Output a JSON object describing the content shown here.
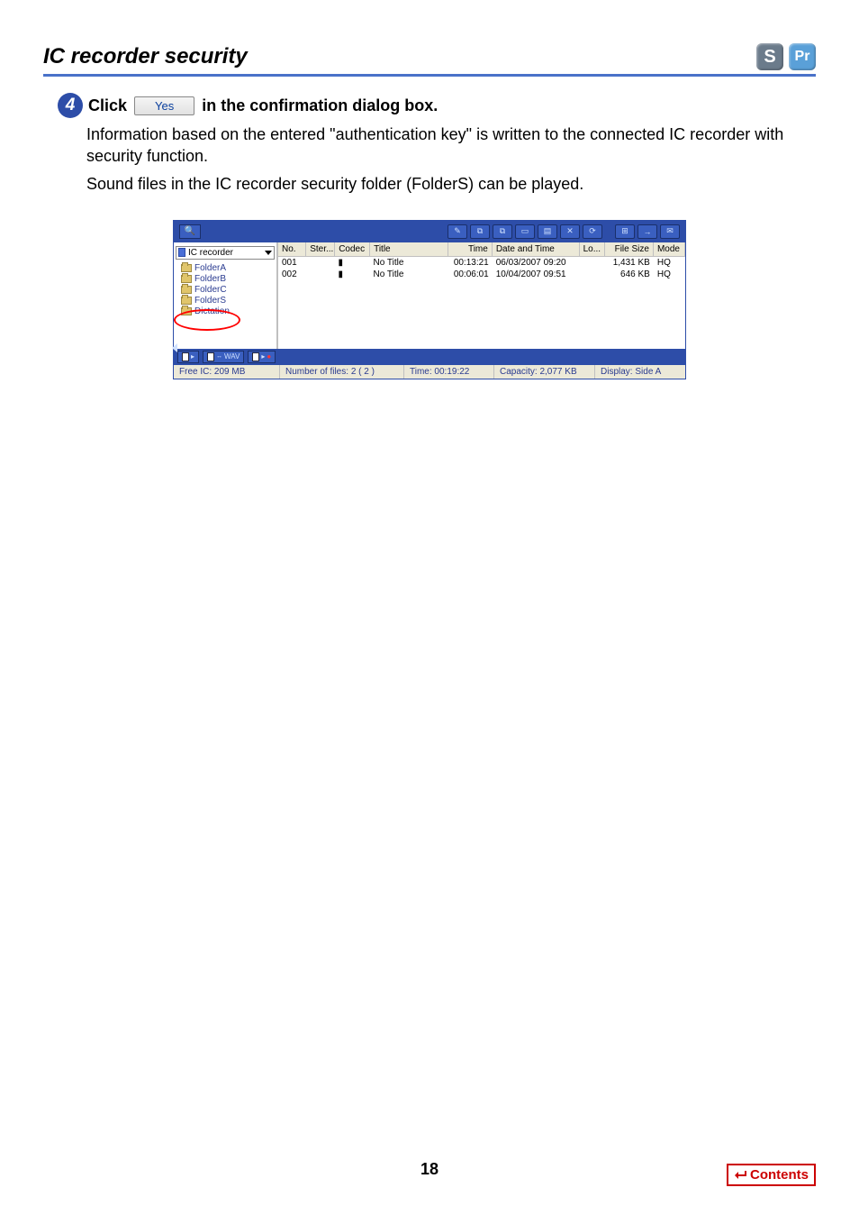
{
  "header": {
    "title": "IC recorder security",
    "badge_s": "S",
    "badge_pr": "Pr"
  },
  "step": {
    "num": "4",
    "pre": "Click",
    "btn": "Yes",
    "post": "in the confirmation dialog box."
  },
  "body": {
    "p1": "Information based on the entered \"authentication key\" is written to the connected IC recorder with security function.",
    "p2": "Sound files in the IC recorder security folder (FolderS) can be played."
  },
  "tree": {
    "top": "IC recorder",
    "items": [
      "FolderA",
      "FolderB",
      "FolderC",
      "FolderS",
      "Dictation"
    ]
  },
  "cols": {
    "no": "No.",
    "ster": "Ster...",
    "codec": "Codec",
    "title": "Title",
    "time": "Time",
    "date": "Date and Time",
    "lo": "Lo...",
    "fs": "File Size",
    "mode": "Mode"
  },
  "rows": [
    {
      "no": "001",
      "title": "No Title",
      "time": "00:13:21",
      "date": "06/03/2007 09:20",
      "fs": "1,431 KB",
      "mode": "HQ"
    },
    {
      "no": "002",
      "title": "No Title",
      "time": "00:06:01",
      "date": "10/04/2007 09:51",
      "fs": "646 KB",
      "mode": "HQ"
    }
  ],
  "tabs": {
    "wav": "WAV"
  },
  "status": {
    "free_l": "Free IC:",
    "free_v": "209 MB",
    "nf_l": "Number of files:",
    "nf_v": "2 ( 2 )",
    "time_l": "Time:",
    "time_v": "00:19:22",
    "cap_l": "Capacity:",
    "cap_v": "2,077 KB",
    "disp_l": "Display:",
    "disp_v": "Side A"
  },
  "footer": {
    "page": "18",
    "contents": "Contents"
  }
}
